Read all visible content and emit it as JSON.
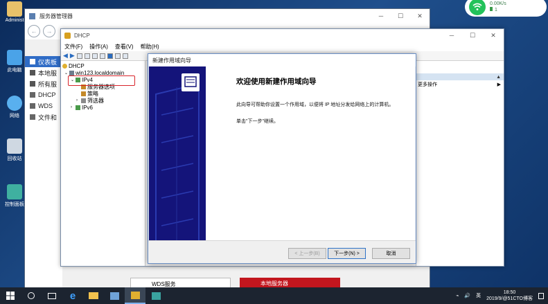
{
  "desktop": {
    "icons": [
      {
        "label": "Administ"
      },
      {
        "label": "此电脑"
      },
      {
        "label": "网络"
      },
      {
        "label": "回收站"
      },
      {
        "label": "控制面板"
      }
    ]
  },
  "net_widget": {
    "speed": "0.00K/s",
    "count": "1"
  },
  "server_manager": {
    "title": "服务器管理器",
    "sidebar": [
      {
        "label": "仪表板",
        "active": true
      },
      {
        "label": "本地服",
        "active": false
      },
      {
        "label": "所有服",
        "active": false
      },
      {
        "label": "DHCP",
        "active": false
      },
      {
        "label": "WDS",
        "active": false
      },
      {
        "label": "文件和",
        "active": false
      }
    ],
    "bottom_tiles": [
      "WDS服务",
      "本地服务器"
    ]
  },
  "dhcp": {
    "title": "DHCP",
    "menu": [
      "文件(F)",
      "操作(A)",
      "查看(V)",
      "帮助(H)"
    ],
    "tree": {
      "root": "DHCP",
      "server": "win123.localdomain",
      "ipv4": "IPv4",
      "children": [
        "服务器选项",
        "策略",
        "筛选器"
      ],
      "ipv6": "IPv6"
    },
    "actions": {
      "more": "更多操作"
    }
  },
  "wizard": {
    "title": "新建作用域向导",
    "heading": "欢迎使用新建作用域向导",
    "para1": "此向导可帮助你设置一个作用域，以便将 IP 地址分发给网络上的计算机。",
    "para2": "单击\"下一步\"继续。",
    "buttons": {
      "back": "< 上一步(B)",
      "next": "下一步(N) >",
      "cancel": "取消"
    }
  },
  "taskbar": {
    "time": "18:50",
    "date": "2019/9/",
    "lang": "英",
    "watermark": "@51CTO博客"
  }
}
